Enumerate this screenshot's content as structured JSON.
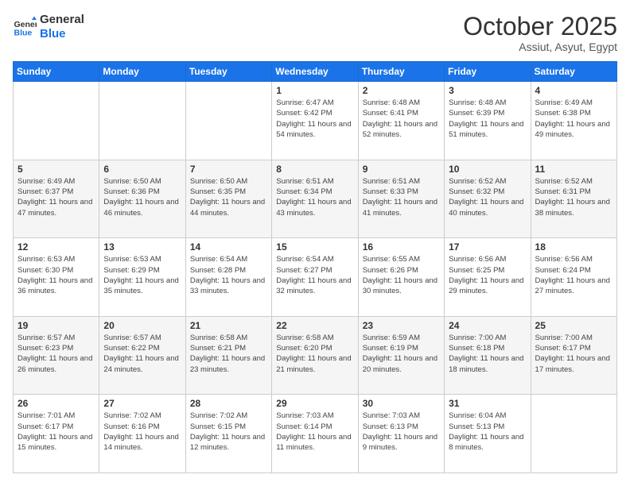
{
  "logo": {
    "line1": "General",
    "line2": "Blue"
  },
  "title": "October 2025",
  "location": "Assiut, Asyut, Egypt",
  "days_of_week": [
    "Sunday",
    "Monday",
    "Tuesday",
    "Wednesday",
    "Thursday",
    "Friday",
    "Saturday"
  ],
  "weeks": [
    [
      {
        "day": "",
        "info": ""
      },
      {
        "day": "",
        "info": ""
      },
      {
        "day": "",
        "info": ""
      },
      {
        "day": "1",
        "sunrise": "6:47 AM",
        "sunset": "6:42 PM",
        "daylight": "11 hours and 54 minutes."
      },
      {
        "day": "2",
        "sunrise": "6:48 AM",
        "sunset": "6:41 PM",
        "daylight": "11 hours and 52 minutes."
      },
      {
        "day": "3",
        "sunrise": "6:48 AM",
        "sunset": "6:39 PM",
        "daylight": "11 hours and 51 minutes."
      },
      {
        "day": "4",
        "sunrise": "6:49 AM",
        "sunset": "6:38 PM",
        "daylight": "11 hours and 49 minutes."
      }
    ],
    [
      {
        "day": "5",
        "sunrise": "6:49 AM",
        "sunset": "6:37 PM",
        "daylight": "11 hours and 47 minutes."
      },
      {
        "day": "6",
        "sunrise": "6:50 AM",
        "sunset": "6:36 PM",
        "daylight": "11 hours and 46 minutes."
      },
      {
        "day": "7",
        "sunrise": "6:50 AM",
        "sunset": "6:35 PM",
        "daylight": "11 hours and 44 minutes."
      },
      {
        "day": "8",
        "sunrise": "6:51 AM",
        "sunset": "6:34 PM",
        "daylight": "11 hours and 43 minutes."
      },
      {
        "day": "9",
        "sunrise": "6:51 AM",
        "sunset": "6:33 PM",
        "daylight": "11 hours and 41 minutes."
      },
      {
        "day": "10",
        "sunrise": "6:52 AM",
        "sunset": "6:32 PM",
        "daylight": "11 hours and 40 minutes."
      },
      {
        "day": "11",
        "sunrise": "6:52 AM",
        "sunset": "6:31 PM",
        "daylight": "11 hours and 38 minutes."
      }
    ],
    [
      {
        "day": "12",
        "sunrise": "6:53 AM",
        "sunset": "6:30 PM",
        "daylight": "11 hours and 36 minutes."
      },
      {
        "day": "13",
        "sunrise": "6:53 AM",
        "sunset": "6:29 PM",
        "daylight": "11 hours and 35 minutes."
      },
      {
        "day": "14",
        "sunrise": "6:54 AM",
        "sunset": "6:28 PM",
        "daylight": "11 hours and 33 minutes."
      },
      {
        "day": "15",
        "sunrise": "6:54 AM",
        "sunset": "6:27 PM",
        "daylight": "11 hours and 32 minutes."
      },
      {
        "day": "16",
        "sunrise": "6:55 AM",
        "sunset": "6:26 PM",
        "daylight": "11 hours and 30 minutes."
      },
      {
        "day": "17",
        "sunrise": "6:56 AM",
        "sunset": "6:25 PM",
        "daylight": "11 hours and 29 minutes."
      },
      {
        "day": "18",
        "sunrise": "6:56 AM",
        "sunset": "6:24 PM",
        "daylight": "11 hours and 27 minutes."
      }
    ],
    [
      {
        "day": "19",
        "sunrise": "6:57 AM",
        "sunset": "6:23 PM",
        "daylight": "11 hours and 26 minutes."
      },
      {
        "day": "20",
        "sunrise": "6:57 AM",
        "sunset": "6:22 PM",
        "daylight": "11 hours and 24 minutes."
      },
      {
        "day": "21",
        "sunrise": "6:58 AM",
        "sunset": "6:21 PM",
        "daylight": "11 hours and 23 minutes."
      },
      {
        "day": "22",
        "sunrise": "6:58 AM",
        "sunset": "6:20 PM",
        "daylight": "11 hours and 21 minutes."
      },
      {
        "day": "23",
        "sunrise": "6:59 AM",
        "sunset": "6:19 PM",
        "daylight": "11 hours and 20 minutes."
      },
      {
        "day": "24",
        "sunrise": "7:00 AM",
        "sunset": "6:18 PM",
        "daylight": "11 hours and 18 minutes."
      },
      {
        "day": "25",
        "sunrise": "7:00 AM",
        "sunset": "6:17 PM",
        "daylight": "11 hours and 17 minutes."
      }
    ],
    [
      {
        "day": "26",
        "sunrise": "7:01 AM",
        "sunset": "6:17 PM",
        "daylight": "11 hours and 15 minutes."
      },
      {
        "day": "27",
        "sunrise": "7:02 AM",
        "sunset": "6:16 PM",
        "daylight": "11 hours and 14 minutes."
      },
      {
        "day": "28",
        "sunrise": "7:02 AM",
        "sunset": "6:15 PM",
        "daylight": "11 hours and 12 minutes."
      },
      {
        "day": "29",
        "sunrise": "7:03 AM",
        "sunset": "6:14 PM",
        "daylight": "11 hours and 11 minutes."
      },
      {
        "day": "30",
        "sunrise": "7:03 AM",
        "sunset": "6:13 PM",
        "daylight": "11 hours and 9 minutes."
      },
      {
        "day": "31",
        "sunrise": "6:04 AM",
        "sunset": "5:13 PM",
        "daylight": "11 hours and 8 minutes."
      },
      {
        "day": "",
        "info": ""
      }
    ]
  ],
  "labels": {
    "sunrise_prefix": "Sunrise: ",
    "sunset_prefix": "Sunset: ",
    "daylight_prefix": "Daylight: "
  }
}
